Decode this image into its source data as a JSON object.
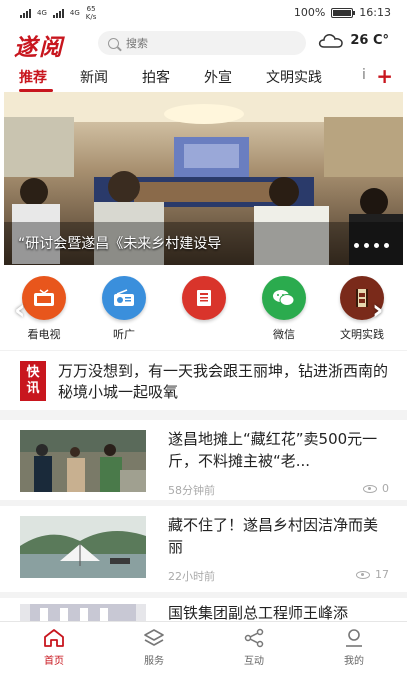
{
  "status_bar": {
    "net1": "4G",
    "net2": "4G",
    "speed_value": "65",
    "speed_unit": "K/s",
    "battery": "100%",
    "time": "16:13"
  },
  "header": {
    "logo": "遂阅",
    "search_placeholder": "搜索",
    "weather_icon": "cloud-icon",
    "temperature": "26 C°"
  },
  "tabs": {
    "items": [
      "推荐",
      "新闻",
      "拍客",
      "外宣",
      "文明实践",
      "i"
    ],
    "active": 0,
    "plus": "+"
  },
  "banner": {
    "caption": "“研讨会暨遂昌《未来乡村建设导",
    "dots": 4
  },
  "quick_icons": [
    {
      "label": "看电视",
      "icon": "tv-icon",
      "color": "#e8561c"
    },
    {
      "label": "听广",
      "icon": "radio-icon",
      "color": "#3a8fdc"
    },
    {
      "label": "",
      "icon": "news-icon",
      "color": "#d9342b"
    },
    {
      "label": "微信",
      "icon": "wechat-icon",
      "color": "#2bab4e"
    },
    {
      "label": "文明实践",
      "icon": "film-icon",
      "color": "#7a2a1a"
    }
  ],
  "flash": {
    "badge_top": "快",
    "badge_bottom": "讯",
    "text": "万万没想到，有一天我会跟王丽坤，钻进浙西南的秘境小城一起吸氧"
  },
  "articles": [
    {
      "title": "遂昌地摊上“藏红花”卖500元一斤，不料摊主被“老...",
      "time": "58分钟前",
      "views": "0"
    },
    {
      "title": "藏不住了！遂昌乡村因洁净而美丽",
      "time": "22小时前",
      "views": "17"
    },
    {
      "title": "国铁集团副总工程师王峰添",
      "time": "",
      "views": ""
    }
  ],
  "bottom_nav": [
    {
      "label": "首页",
      "icon": "home-icon",
      "active": true
    },
    {
      "label": "服务",
      "icon": "service-icon",
      "active": false
    },
    {
      "label": "互动",
      "icon": "share-icon",
      "active": false
    },
    {
      "label": "我的",
      "icon": "user-icon",
      "active": false
    }
  ],
  "colors": {
    "accent": "#c8161e"
  }
}
